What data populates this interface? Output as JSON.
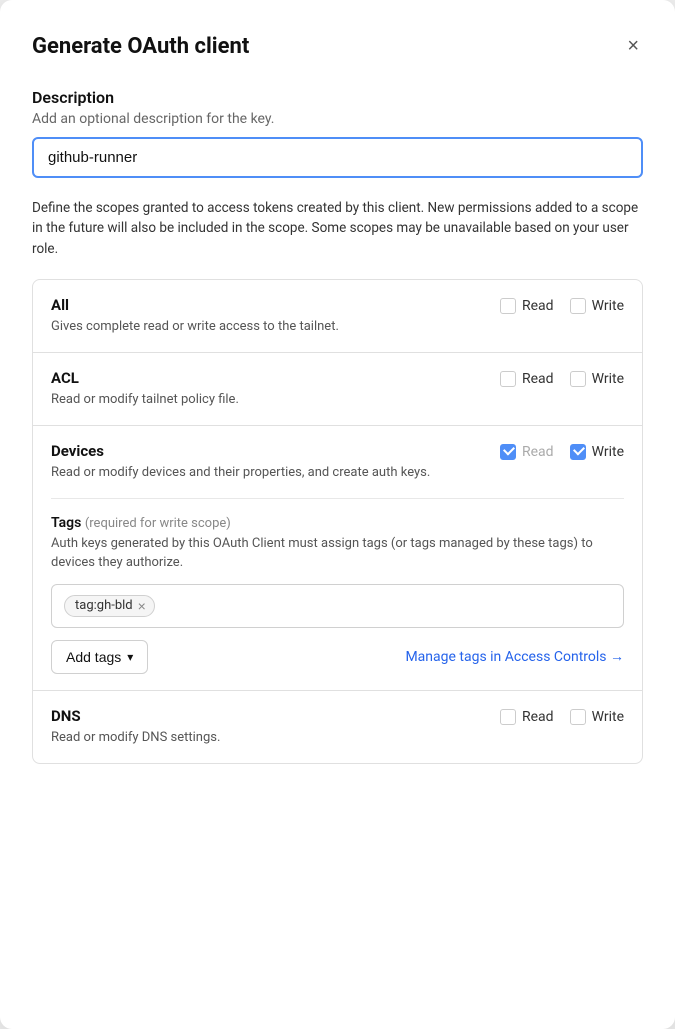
{
  "modal": {
    "title": "Generate OAuth client",
    "close_label": "×"
  },
  "description_section": {
    "label": "Description",
    "sublabel": "Add an optional description for the key.",
    "input_value": "github-runner",
    "input_placeholder": "github-runner"
  },
  "scopes_info": "Define the scopes granted to access tokens created by this client. New permissions added to a scope in the future will also be included in the scope. Some scopes may be unavailable based on your user role.",
  "scopes": [
    {
      "id": "all",
      "name": "All",
      "description": "Gives complete read or write access to the tailnet.",
      "read_checked": false,
      "write_checked": false,
      "has_tags": false
    },
    {
      "id": "acl",
      "name": "ACL",
      "description": "Read or modify tailnet policy file.",
      "read_checked": false,
      "write_checked": false,
      "has_tags": false
    },
    {
      "id": "devices",
      "name": "Devices",
      "description": "Read or modify devices and their properties, and create auth keys.",
      "read_checked": true,
      "write_checked": true,
      "has_tags": true
    },
    {
      "id": "dns",
      "name": "DNS",
      "description": "Read or modify DNS settings.",
      "read_checked": false,
      "write_checked": false,
      "has_tags": false
    }
  ],
  "tags_subsection": {
    "label": "Tags",
    "required_note": "(required for write scope)",
    "description": "Auth keys generated by this OAuth Client must assign tags (or tags managed by these tags) to devices they authorize.",
    "tags": [
      {
        "value": "tag:gh-bld"
      }
    ]
  },
  "add_tags_button": {
    "label": "Add tags",
    "chevron": "▾"
  },
  "manage_tags_link": {
    "label": "Manage tags in Access Controls →"
  },
  "read_label": "Read",
  "write_label": "Write"
}
